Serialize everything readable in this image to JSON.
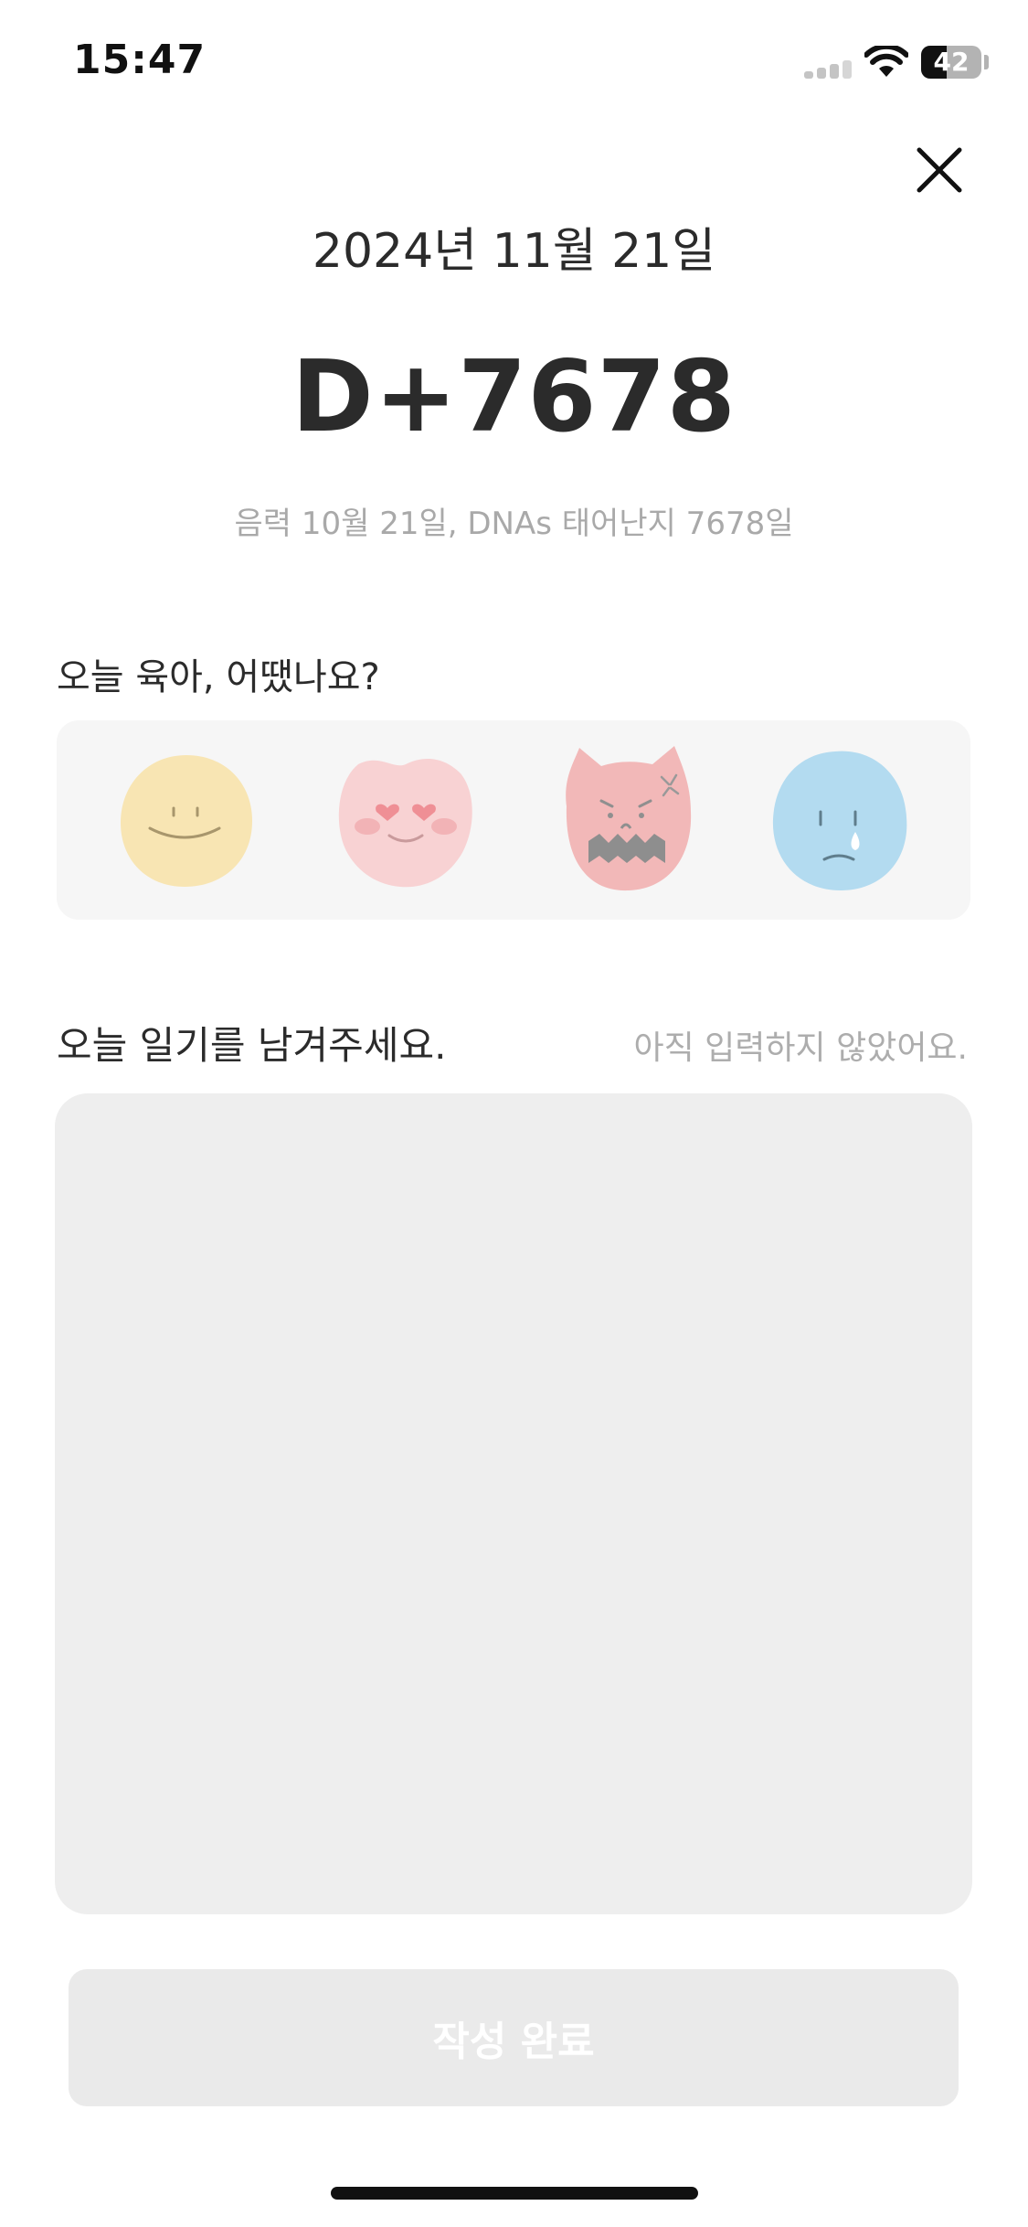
{
  "status_bar": {
    "time": "15:47",
    "battery_percent": "42",
    "battery_level": 0.42
  },
  "header": {
    "close_icon": "close-icon",
    "date": "2024년 11월 21일",
    "dday": "D+7678",
    "lunar_info": "음력 10월 21일, DNAs 태어난지 7678일"
  },
  "mood": {
    "label": "오늘 육아, 어땠나요?",
    "options": [
      {
        "name": "happy",
        "color": "#f8e5b3"
      },
      {
        "name": "love",
        "color": "#f8d2d3"
      },
      {
        "name": "angry",
        "color": "#f2b8b8"
      },
      {
        "name": "sad",
        "color": "#b3dbf0"
      }
    ]
  },
  "diary": {
    "label": "오늘 일기를 남겨주세요.",
    "status": "아직 입력하지 않았어요.",
    "value": ""
  },
  "submit": {
    "label": "작성 완료"
  }
}
